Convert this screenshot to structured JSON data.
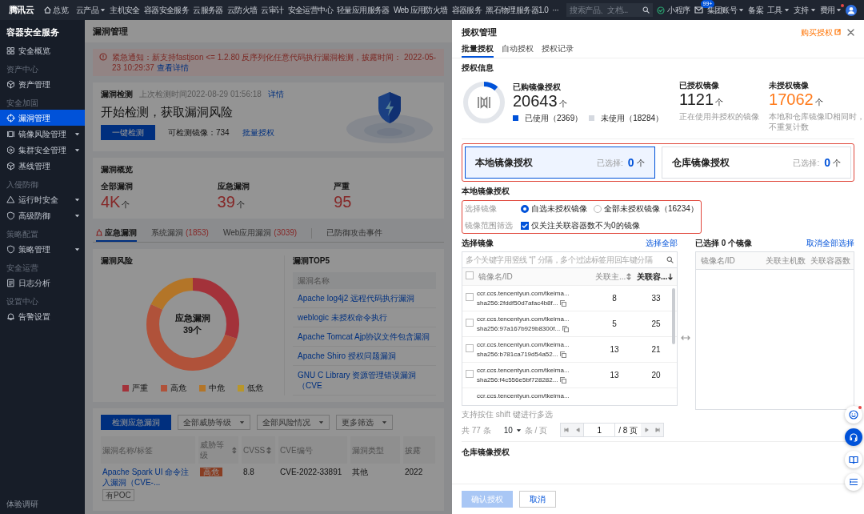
{
  "topbar": {
    "brand": "腾讯云",
    "home": "总览",
    "menu": [
      {
        "label": "云产品",
        "dropdown": true
      },
      {
        "label": "主机安全",
        "dropdown": false
      },
      {
        "label": "容器安全服务",
        "dropdown": false
      },
      {
        "label": "云服务器",
        "dropdown": false
      },
      {
        "label": "云防火墙",
        "dropdown": false
      },
      {
        "label": "云审计",
        "dropdown": false
      },
      {
        "label": "安全运营中心",
        "dropdown": false
      },
      {
        "label": "轻量应用服务器",
        "dropdown": false
      },
      {
        "label": "Web 应用防火墙",
        "dropdown": false
      },
      {
        "label": "容器服务",
        "dropdown": false
      },
      {
        "label": "黑石物理服务器1.0",
        "dropdown": false
      }
    ],
    "more": "···",
    "search": {
      "placeholder": "搜索产品、文档..."
    },
    "mini_program": "小程序",
    "mail_badge": "99+",
    "right_menu": [
      {
        "label": "集团账号",
        "dropdown": true,
        "notice": false
      },
      {
        "label": "备案",
        "dropdown": false,
        "notice": false
      },
      {
        "label": "工具",
        "dropdown": true,
        "notice": false
      },
      {
        "label": "支持",
        "dropdown": true,
        "notice": false
      },
      {
        "label": "费用",
        "dropdown": true,
        "notice": true
      }
    ]
  },
  "sidebar": {
    "title": "容器安全服务",
    "sections": [
      {
        "items": [
          {
            "label": "安全概览",
            "selected": false,
            "expandable": false
          }
        ]
      },
      {
        "label": "资产中心",
        "items": [
          {
            "label": "资产管理",
            "selected": false,
            "expandable": false
          }
        ]
      },
      {
        "label": "安全加固",
        "items": [
          {
            "label": "漏洞管理",
            "selected": true,
            "expandable": false
          },
          {
            "label": "镜像风险管理",
            "selected": false,
            "expandable": true
          },
          {
            "label": "集群安全管理",
            "selected": false,
            "expandable": true
          },
          {
            "label": "基线管理",
            "selected": false,
            "expandable": false
          }
        ]
      },
      {
        "label": "入侵防御",
        "items": [
          {
            "label": "运行时安全",
            "selected": false,
            "expandable": true
          },
          {
            "label": "高级防御",
            "selected": false,
            "expandable": true
          }
        ]
      },
      {
        "label": "策略配置",
        "items": [
          {
            "label": "策略管理",
            "selected": false,
            "expandable": true
          }
        ]
      },
      {
        "label": "安全运营",
        "items": [
          {
            "label": "日志分析",
            "selected": false,
            "expandable": false
          }
        ]
      },
      {
        "label": "设置中心",
        "items": [
          {
            "label": "告警设置",
            "selected": false,
            "expandable": false
          }
        ]
      }
    ],
    "footer": "体验调研"
  },
  "main": {
    "title": "漏洞管理",
    "alert": {
      "text": "紧急通知：新支持fastjson <= 1.2.80 反序列化任意代码执行漏洞检测，披露时间： 2022-05-23 10:29:37",
      "link": "查看详情"
    },
    "detection": {
      "title": "漏洞检测",
      "last_check": "上次检测时间2022-08-29 01:56:18",
      "detail_link": "详情",
      "headline": "开始检测，获取漏洞风险",
      "button": "一键检测",
      "detectable": "可检测镜像：734",
      "batch_link": "批量授权"
    },
    "overview": {
      "title": "漏洞概览",
      "stats": [
        {
          "label": "全部漏洞",
          "value": "4K",
          "unit": "个"
        },
        {
          "label": "应急漏洞",
          "value": "39",
          "unit": "个"
        },
        {
          "label": "严重",
          "value": "95"
        }
      ]
    },
    "tabs": [
      {
        "label": "应急漏洞",
        "selected": true
      },
      {
        "label": "系统漏洞",
        "count": "(1853)",
        "selected": false
      },
      {
        "label": "Web应用漏洞",
        "count": "(3039)",
        "selected": false
      },
      {
        "label": "已防御攻击事件",
        "selected": false
      }
    ],
    "risk": {
      "title": "漏洞风险",
      "center_label": "应急漏洞",
      "center_value": "39个",
      "legend": [
        {
          "label": "严重",
          "color": "#a3323a"
        },
        {
          "label": "高危",
          "color": "#b0523a"
        },
        {
          "label": "中危",
          "color": "#b37528"
        },
        {
          "label": "低危",
          "color": "#b8962a"
        }
      ]
    },
    "top5": {
      "title": "漏洞TOP5",
      "column": "漏洞名称",
      "items": [
        "Apache log4j2 远程代码执行漏洞",
        "weblogic 未授权命令执行",
        "Apache Tomcat Ajp协议文件包含漏洞",
        "Apache Shiro 授权问题漏洞",
        "GNU C Library 资源管理错误漏洞（CVE"
      ]
    },
    "list": {
      "button": "检测应急漏洞",
      "filters": [
        "全部威胁等级",
        "全部风险情况",
        "更多筛选"
      ],
      "columns": [
        {
          "label": "漏洞名称/标签",
          "sortable": false
        },
        {
          "label": "威胁等级",
          "sortable": true
        },
        {
          "label": "CVSS",
          "sortable": true
        },
        {
          "label": "CVE编号",
          "sortable": false
        },
        {
          "label": "漏洞类型",
          "sortable": false
        },
        {
          "label": "披露",
          "sortable": false
        }
      ],
      "rows": [
        {
          "name": "Apache Spark UI 命令注入漏洞（CVE-...",
          "tag": "有POC",
          "severity": "高危",
          "cvss": "8.8",
          "cve": "CVE-2022-33891",
          "type": "其他",
          "date": "2022"
        }
      ]
    }
  },
  "drawer": {
    "title": "授权管理",
    "buy_link": "购买授权",
    "tabs": [
      {
        "label": "批量授权",
        "selected": true
      },
      {
        "label": "自动授权",
        "selected": false
      },
      {
        "label": "授权记录",
        "selected": false
      }
    ],
    "info": {
      "title": "授权信息",
      "purchased": {
        "label": "已购镜像授权",
        "value": "20643",
        "unit": "个",
        "level": 0.115,
        "used": "已使用（2369）",
        "unused": "未使用（18284）"
      },
      "authorized": {
        "label": "已授权镜像",
        "value": "1121",
        "unit": "个",
        "note": "正在使用并授权的镜像"
      },
      "unauthorized": {
        "label": "未授权镜像",
        "value": "17062",
        "unit": "个",
        "note": "本地和仓库镜像ID相同时，不重复计数"
      }
    },
    "modes_highlighted": true,
    "modes": [
      {
        "title": "本地镜像授权",
        "selected_label": "已选择:",
        "count": "0",
        "unit": "个",
        "selected": true
      },
      {
        "title": "仓库镜像授权",
        "selected_label": "已选择:",
        "count": "0",
        "unit": "个",
        "selected": false
      }
    ],
    "local": {
      "title": "本地镜像授权",
      "highlighted": true,
      "select_label": "选择镜像",
      "options": [
        {
          "label": "自选未授权镜像",
          "selected": true
        },
        {
          "label": "全部未授权镜像（16234）",
          "selected": false
        }
      ],
      "filter_label": "镜像范围筛选",
      "filter": {
        "label": "仅关注关联容器数不为0的镜像",
        "checked": true
      }
    },
    "transfer": {
      "left_title": "选择镜像",
      "select_all": "选择全部",
      "search_placeholder": "多个关键字用竖线 “|” 分隔，多个过滤标签用回车键分隔",
      "header_checked": false,
      "columns": [
        {
          "label": "镜像名/ID",
          "sortable": false,
          "sorted_desc": false
        },
        {
          "label": "关联主...",
          "sortable": true,
          "sorted_desc": false
        },
        {
          "label": "关联容...",
          "sortable": true,
          "sorted_desc": true
        }
      ],
      "rows": [
        {
          "name": "ccr.ccs.tencentyun.com/tkeima...",
          "id": "sha256:2fddf50d7afac4b8f...",
          "hosts": "8",
          "containers": "33",
          "checked": false
        },
        {
          "name": "ccr.ccs.tencentyun.com/tkeima...",
          "id": "sha256:97a167b929b8300f...",
          "hosts": "5",
          "containers": "25",
          "checked": false
        },
        {
          "name": "ccr.ccs.tencentyun.com/tkeima...",
          "id": "sha256:b781ca719d54a52...",
          "hosts": "13",
          "containers": "21",
          "checked": false
        },
        {
          "name": "ccr.ccs.tencentyun.com/tkeima...",
          "id": "sha256:f4c556e5bf728282...",
          "hosts": "13",
          "containers": "20",
          "checked": false
        }
      ],
      "partial_row": "ccr.ccs.tencentyun.com/tkeima...",
      "hint": "支持按住 shift 键进行多选",
      "total": "共 77 条",
      "page_size": "10",
      "per_page": "条 / 页",
      "page": "1",
      "pages": "/ 8 页",
      "right_title": "已选择 0 个镜像",
      "clear_all": "取消全部选择",
      "right_columns": [
        "镜像名/ID",
        "关联主机数",
        "关联容器数"
      ]
    },
    "repo_title": "仓库镜像授权",
    "footer": {
      "confirm": {
        "label": "确认授权",
        "disabled": true
      },
      "cancel": "取消"
    }
  },
  "float_buttons": [
    {
      "highlighted": false,
      "notice": true
    },
    {
      "highlighted": true,
      "notice": false
    },
    {
      "highlighted": false,
      "notice": false
    },
    {
      "highlighted": false,
      "notice": false
    }
  ]
}
